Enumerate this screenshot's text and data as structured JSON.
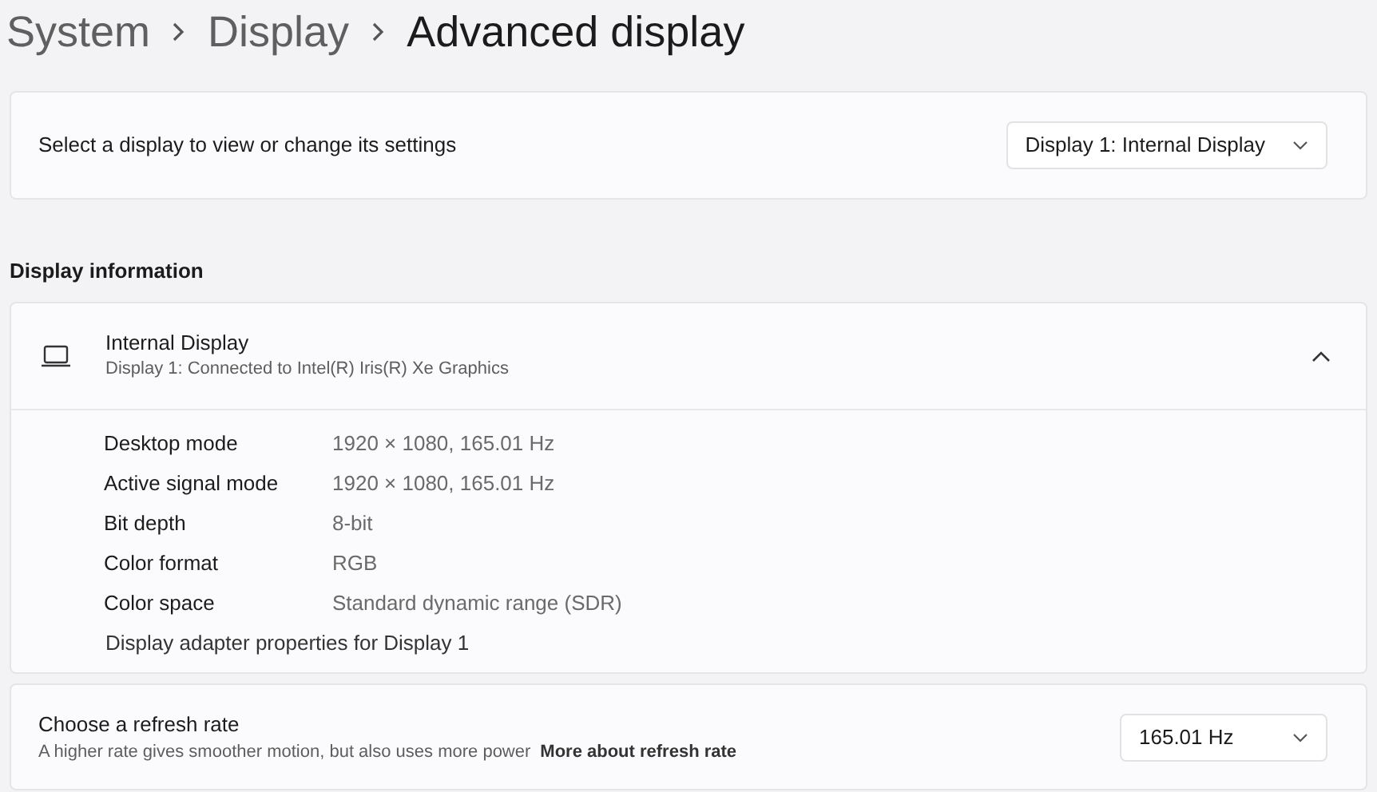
{
  "breadcrumb": [
    "System",
    "Display",
    "Advanced display"
  ],
  "display_select": {
    "label": "Select a display to view or change its settings",
    "value": "Display 1: Internal Display"
  },
  "section_title": "Display information",
  "display_info": {
    "title": "Internal Display",
    "subtitle": "Display 1: Connected to Intel(R) Iris(R) Xe Graphics",
    "expanded": true,
    "rows": [
      {
        "label": "Desktop mode",
        "value": "1920 × 1080, 165.01 Hz"
      },
      {
        "label": "Active signal mode",
        "value": "1920 × 1080, 165.01 Hz"
      },
      {
        "label": "Bit depth",
        "value": "8-bit"
      },
      {
        "label": "Color format",
        "value": "RGB"
      },
      {
        "label": "Color space",
        "value": "Standard dynamic range (SDR)"
      }
    ],
    "link": "Display adapter properties for Display 1"
  },
  "refresh_rate": {
    "title": "Choose a refresh rate",
    "description": "A higher rate gives smoother motion, but also uses more power",
    "link": "More about refresh rate",
    "value": "165.01 Hz"
  }
}
